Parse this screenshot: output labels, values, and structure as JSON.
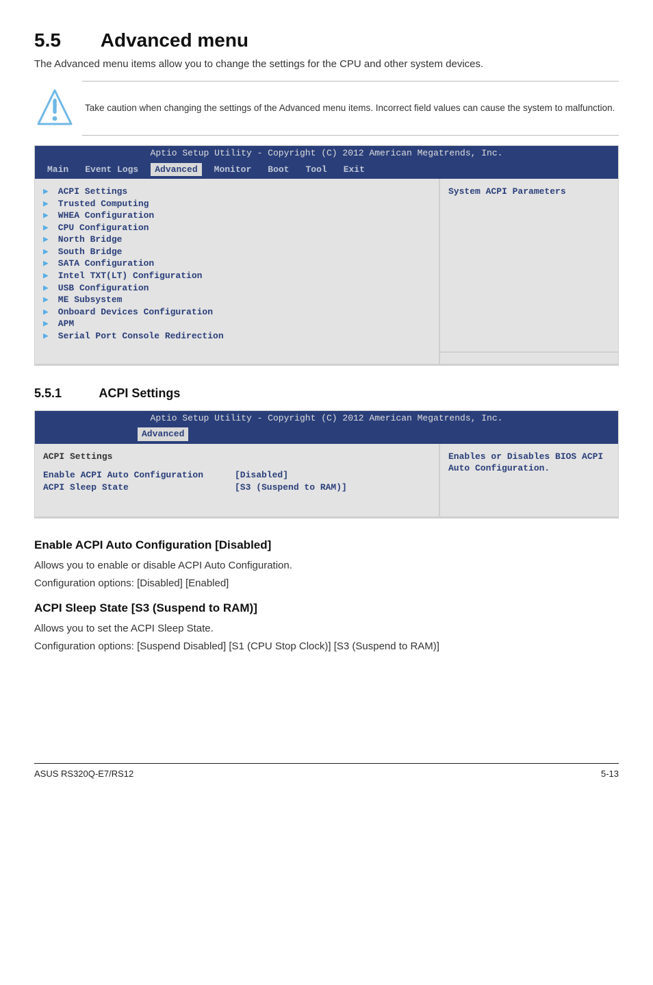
{
  "heading": {
    "num": "5.5",
    "title": "Advanced menu"
  },
  "lead": "The Advanced menu items allow you to change the settings for the CPU and other system devices.",
  "caution": "Take caution when changing the settings of the Advanced menu items. Incorrect field values can cause the system to malfunction.",
  "bios1": {
    "header": "Aptio Setup Utility - Copyright (C) 2012 American Megatrends, Inc.",
    "tabs": [
      "Main",
      "Event Logs",
      "Advanced",
      "Monitor",
      "Boot",
      "Tool",
      "Exit"
    ],
    "active_tab": "Advanced",
    "items": [
      "ACPI Settings",
      "Trusted Computing",
      "WHEA Configuration",
      "CPU Configuration",
      "North Bridge",
      "South Bridge",
      "SATA Configuration",
      "Intel TXT(LT) Configuration",
      "USB Configuration",
      "ME Subsystem",
      "Onboard Devices Configuration",
      "APM",
      "Serial Port Console Redirection"
    ],
    "help": "System ACPI Parameters"
  },
  "subsection": {
    "num": "5.5.1",
    "title": "ACPI Settings"
  },
  "bios2": {
    "header": "Aptio Setup Utility - Copyright (C) 2012 American Megatrends, Inc.",
    "active_tab": "Advanced",
    "section_title": "ACPI Settings",
    "rows": [
      {
        "k": "Enable ACPI Auto Configuration",
        "v": "[Disabled]"
      },
      {
        "k": "ACPI Sleep State",
        "v": "[S3 (Suspend to RAM)]"
      }
    ],
    "help": "Enables or Disables BIOS ACPI Auto Configuration."
  },
  "setting1": {
    "title": "Enable ACPI Auto Configuration [Disabled]",
    "desc": "Allows you to enable or disable ACPI Auto Configuration.",
    "opts": "Configuration options: [Disabled] [Enabled]"
  },
  "setting2": {
    "title": "ACPI Sleep State [S3 (Suspend to RAM)]",
    "desc": "Allows you to set the ACPI Sleep State.",
    "opts": "Configuration options: [Suspend Disabled] [S1 (CPU Stop Clock)] [S3 (Suspend to RAM)]"
  },
  "footer": {
    "left": "ASUS RS320Q-E7/RS12",
    "right": "5-13"
  }
}
